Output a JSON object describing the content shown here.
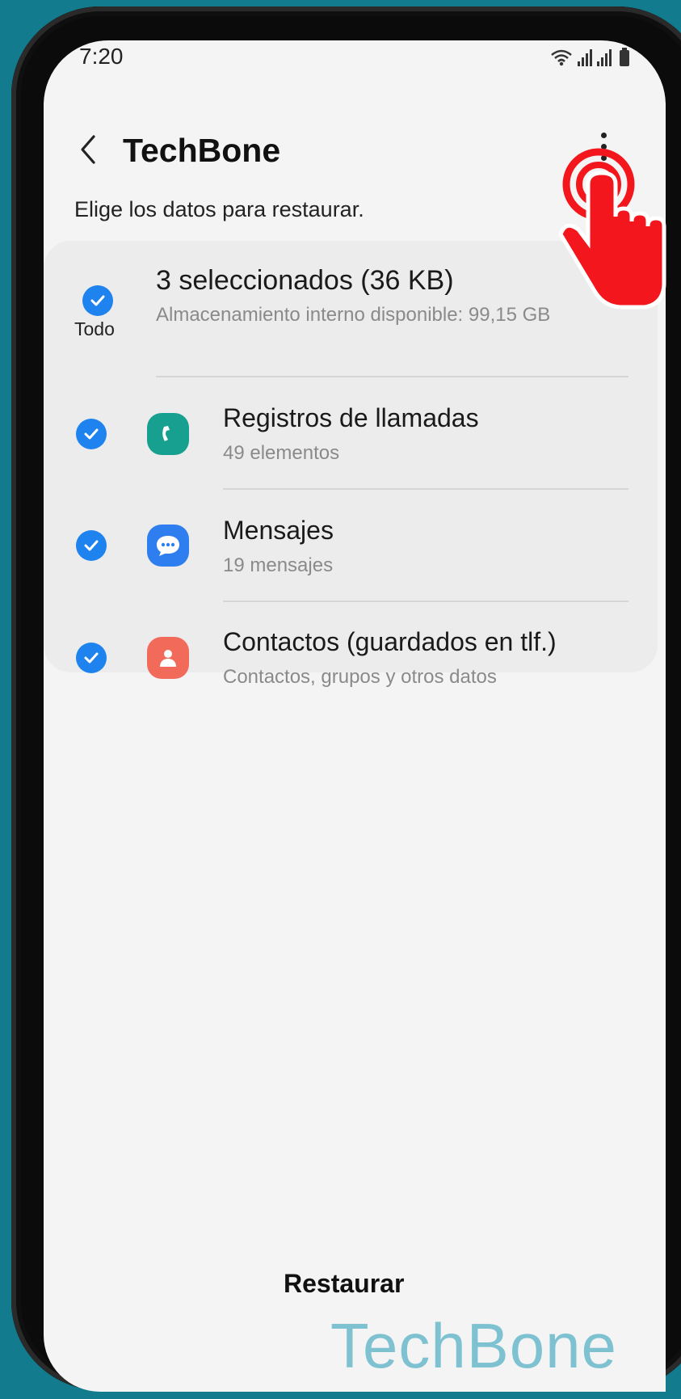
{
  "status_bar": {
    "time": "7:20"
  },
  "header": {
    "title": "TechBone"
  },
  "subtitle": "Elige los datos para restaurar.",
  "select_all": {
    "label": "Todo",
    "summary": "3 seleccionados (36 KB)",
    "storage": "Almacenamiento interno disponible: 99,15 GB"
  },
  "items": [
    {
      "title": "Registros de llamadas",
      "subtitle": "49 elementos",
      "icon": "phone-icon",
      "color": "#17a08f",
      "checked": true
    },
    {
      "title": "Mensajes",
      "subtitle": "19 mensajes",
      "icon": "message-icon",
      "color": "#2f7ef0",
      "checked": true
    },
    {
      "title": "Contactos (guardados en tlf.)",
      "subtitle": "Contactos, grupos y otros datos",
      "icon": "contact-icon",
      "color": "#f26a5a",
      "checked": true
    }
  ],
  "footer": {
    "restore_label": "Restaurar"
  },
  "watermark": "TechBone",
  "colors": {
    "accent": "#1e83ee",
    "background": "#f4f4f4",
    "pointer": "#f3161d"
  }
}
